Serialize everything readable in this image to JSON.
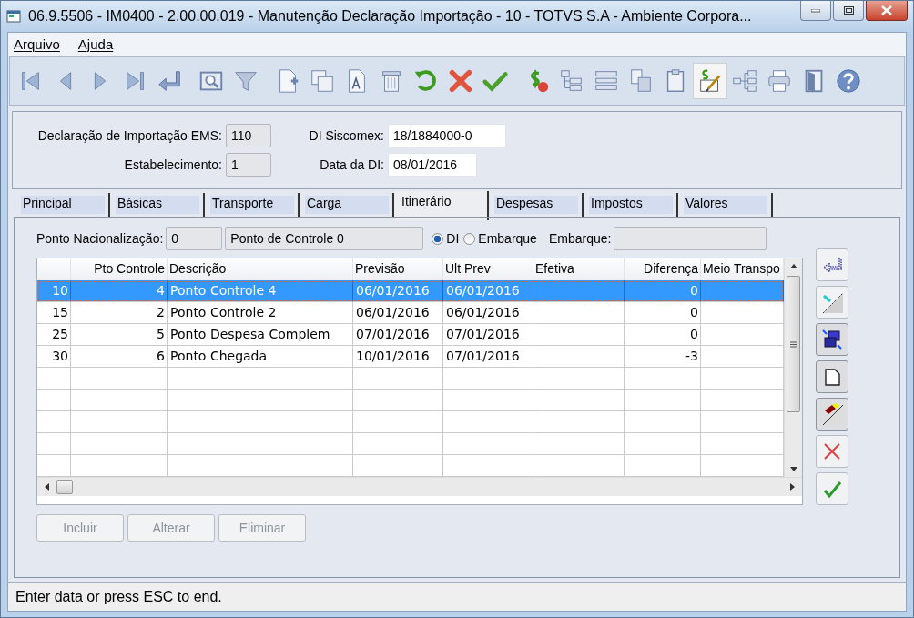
{
  "window": {
    "title": "06.9.5506 - IM0400 - 2.00.00.019 - Manutenção Declaração Importação - 10 - TOTVS S.A - Ambiente Corpora..."
  },
  "menu": [
    {
      "label": "Arquivo"
    },
    {
      "label": "Ajuda"
    }
  ],
  "toolbar": [
    {
      "pressed": false
    },
    {
      "pressed": false
    },
    {
      "pressed": false
    },
    {
      "pressed": false
    },
    {
      "pressed": false
    },
    {
      "pressed": false
    },
    {
      "pressed": false
    },
    {
      "pressed": false
    },
    {
      "pressed": false
    },
    {
      "pressed": false
    },
    {
      "pressed": false
    },
    {
      "pressed": false
    },
    {
      "pressed": false
    },
    {
      "pressed": false
    },
    {
      "pressed": false
    },
    {
      "pressed": false
    },
    {
      "pressed": false
    },
    {
      "pressed": false
    },
    {
      "pressed": false
    },
    {
      "pressed": true
    },
    {
      "pressed": false
    },
    {
      "pressed": false
    },
    {
      "pressed": false
    },
    {
      "pressed": false
    }
  ],
  "header": {
    "declaracao_label": "Declaração de Importação EMS:",
    "declaracao_value": "110",
    "siscomex_label": "DI Siscomex:",
    "siscomex_value": "18/1884000-0",
    "estabelecimento_label": "Estabelecimento:",
    "estabelecimento_value": "1",
    "data_label": "Data da DI:",
    "data_value": "08/01/2016"
  },
  "tabs": [
    {
      "label": "Principal",
      "selected": false
    },
    {
      "label": "Básicas",
      "selected": false
    },
    {
      "label": "Transporte",
      "selected": false
    },
    {
      "label": "Carga",
      "selected": false
    },
    {
      "label": "Itinerário",
      "selected": true
    },
    {
      "label": "Despesas",
      "selected": false
    },
    {
      "label": "Impostos",
      "selected": false
    },
    {
      "label": "Valores",
      "selected": false
    }
  ],
  "itinerario": {
    "ponto_label": "Ponto Nacionalização:",
    "ponto_value": "0",
    "ponto_desc": "Ponto de Controle 0",
    "radios": [
      {
        "label": "DI",
        "selected": true
      },
      {
        "label": "Embarque",
        "selected": false
      }
    ],
    "embarque_label": "Embarque:",
    "columns": [
      "Pto Controle",
      "Descrição",
      "Previsão",
      "Ult Prev",
      "Efetiva",
      "Diferença",
      "Meio Transpo"
    ],
    "rows": [
      {
        "seq": "10",
        "pto": "4",
        "descricao": "Ponto Controle 4",
        "previsao": "06/01/2016",
        "ult_prev": "06/01/2016",
        "diferenca": "0",
        "selected": true
      },
      {
        "seq": "15",
        "pto": "2",
        "descricao": "Ponto Controle 2",
        "previsao": "06/01/2016",
        "ult_prev": "06/01/2016",
        "diferenca": "0",
        "selected": false
      },
      {
        "seq": "25",
        "pto": "5",
        "descricao": "Ponto Despesa Complem",
        "previsao": "07/01/2016",
        "ult_prev": "07/01/2016",
        "diferenca": "0",
        "selected": false
      },
      {
        "seq": "30",
        "pto": "6",
        "descricao": "Ponto Chegada",
        "previsao": "10/01/2016",
        "ult_prev": "07/01/2016",
        "diferenca": "-3",
        "selected": false
      }
    ],
    "buttons": [
      {
        "label": "Incluir",
        "disabled": true
      },
      {
        "label": "Alterar",
        "disabled": true
      },
      {
        "label": "Eliminar",
        "disabled": true
      }
    ]
  },
  "status_bar": {
    "text": "Enter data or press ESC to end."
  }
}
